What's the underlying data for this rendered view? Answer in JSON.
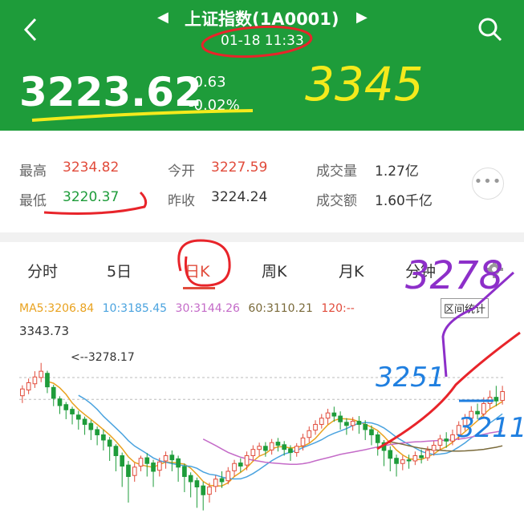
{
  "header": {
    "title": "上证指数(1A0001)",
    "time": "01-18 11:33",
    "price": "3223.62",
    "change": "-0.63",
    "change_pct": "-0.02%",
    "prev_symbol": "◀",
    "next_symbol": "▶"
  },
  "stats": {
    "high_label": "最高",
    "high_value": "3234.82",
    "low_label": "最低",
    "low_value": "3220.37",
    "open_label": "今开",
    "open_value": "3227.59",
    "prev_close_label": "昨收",
    "prev_close_value": "3224.24",
    "volume_label": "成交量",
    "volume_value": "1.27亿",
    "amount_label": "成交额",
    "amount_value": "1.60千亿",
    "more": "•••"
  },
  "tabs": [
    "分时",
    "5日",
    "日K",
    "周K",
    "月K",
    "分钟"
  ],
  "active_tab": "日K",
  "ma": {
    "ma5": "MA5:3206.84",
    "ma10": "10:3185.45",
    "ma30": "30:3144.26",
    "ma60": "60:3110.21",
    "ma120": "120:--"
  },
  "range_button": "区间统计",
  "chart": {
    "max_label": "3343.73",
    "high_marker": "<--3278.17"
  },
  "colors": {
    "header_bg": "#1e9c3a",
    "up": "#e14b3b",
    "down": "#1e9c3a",
    "ma5": "#e9a21f",
    "ma10": "#4aa3df",
    "ma30": "#c46bc8",
    "ma60": "#7a6a3a",
    "annotation_yellow": "#f4ea1c",
    "annotation_red": "#e8242a",
    "annotation_purple": "#8d2fc9",
    "annotation_blue": "#1f7fe0"
  },
  "icons": {
    "back": "chevron-left-icon",
    "search": "search-icon",
    "settings": "gear-icon"
  },
  "handwritten": {
    "yellow_note": "3345",
    "purple_note": "3278",
    "blue_note_1": "3251",
    "blue_note_2": "3211"
  },
  "chart_data": {
    "type": "candlestick",
    "ylim": [
      2990,
      3343.73
    ],
    "candles_ohlc": [
      [
        3215,
        3228,
        3201,
        3235
      ],
      [
        3226,
        3240,
        3218,
        3248
      ],
      [
        3238,
        3251,
        3230,
        3262
      ],
      [
        3250,
        3262,
        3241,
        3278
      ],
      [
        3258,
        3232,
        3220,
        3263
      ],
      [
        3231,
        3210,
        3195,
        3236
      ],
      [
        3209,
        3196,
        3180,
        3214
      ],
      [
        3198,
        3188,
        3170,
        3203
      ],
      [
        3189,
        3180,
        3160,
        3194
      ],
      [
        3178,
        3170,
        3150,
        3186
      ],
      [
        3170,
        3160,
        3140,
        3175
      ],
      [
        3162,
        3150,
        3130,
        3168
      ],
      [
        3150,
        3140,
        3120,
        3156
      ],
      [
        3140,
        3130,
        3110,
        3150
      ],
      [
        3130,
        3118,
        3090,
        3136
      ],
      [
        3118,
        3100,
        3070,
        3122
      ],
      [
        3100,
        3080,
        3040,
        3106
      ],
      [
        3082,
        3060,
        3010,
        3090
      ],
      [
        3062,
        3078,
        3050,
        3086
      ],
      [
        3080,
        3095,
        3070,
        3100
      ],
      [
        3096,
        3085,
        3060,
        3105
      ],
      [
        3086,
        3070,
        3040,
        3092
      ],
      [
        3072,
        3088,
        3060,
        3096
      ],
      [
        3090,
        3100,
        3075,
        3108
      ],
      [
        3101,
        3092,
        3070,
        3110
      ],
      [
        3094,
        3078,
        3050,
        3100
      ],
      [
        3079,
        3060,
        3030,
        3085
      ],
      [
        3062,
        3050,
        3020,
        3068
      ],
      [
        3052,
        3040,
        3000,
        3058
      ],
      [
        3042,
        3025,
        2995,
        3050
      ],
      [
        3026,
        3040,
        3010,
        3048
      ],
      [
        3041,
        3055,
        3030,
        3062
      ],
      [
        3056,
        3050,
        3038,
        3070
      ],
      [
        3052,
        3070,
        3045,
        3078
      ],
      [
        3071,
        3085,
        3060,
        3092
      ],
      [
        3086,
        3080,
        3068,
        3095
      ],
      [
        3082,
        3100,
        3072,
        3108
      ],
      [
        3100,
        3112,
        3090,
        3120
      ],
      [
        3112,
        3118,
        3100,
        3125
      ],
      [
        3118,
        3110,
        3098,
        3126
      ],
      [
        3111,
        3125,
        3102,
        3132
      ],
      [
        3126,
        3120,
        3108,
        3134
      ],
      [
        3121,
        3112,
        3100,
        3128
      ],
      [
        3113,
        3106,
        3090,
        3120
      ],
      [
        3106,
        3118,
        3098,
        3124
      ],
      [
        3119,
        3134,
        3110,
        3142
      ],
      [
        3135,
        3148,
        3125,
        3156
      ],
      [
        3149,
        3160,
        3140,
        3168
      ],
      [
        3160,
        3172,
        3152,
        3180
      ],
      [
        3172,
        3182,
        3160,
        3190
      ],
      [
        3182,
        3176,
        3165,
        3194
      ],
      [
        3176,
        3165,
        3150,
        3185
      ],
      [
        3164,
        3158,
        3140,
        3172
      ],
      [
        3158,
        3166,
        3148,
        3174
      ],
      [
        3166,
        3160,
        3142,
        3176
      ],
      [
        3160,
        3150,
        3130,
        3168
      ],
      [
        3150,
        3140,
        3120,
        3158
      ],
      [
        3140,
        3125,
        3100,
        3146
      ],
      [
        3125,
        3110,
        3080,
        3130
      ],
      [
        3110,
        3095,
        3070,
        3118
      ],
      [
        3095,
        3085,
        3060,
        3102
      ],
      [
        3085,
        3092,
        3072,
        3100
      ],
      [
        3092,
        3090,
        3075,
        3102
      ],
      [
        3090,
        3100,
        3082,
        3108
      ],
      [
        3100,
        3096,
        3085,
        3112
      ],
      [
        3096,
        3110,
        3090,
        3118
      ],
      [
        3110,
        3120,
        3100,
        3128
      ],
      [
        3120,
        3132,
        3110,
        3140
      ],
      [
        3132,
        3128,
        3115,
        3145
      ],
      [
        3128,
        3140,
        3120,
        3150
      ],
      [
        3140,
        3158,
        3130,
        3166
      ],
      [
        3158,
        3172,
        3148,
        3180
      ],
      [
        3172,
        3185,
        3160,
        3195
      ],
      [
        3185,
        3180,
        3170,
        3200
      ],
      [
        3180,
        3200,
        3172,
        3212
      ],
      [
        3200,
        3212,
        3190,
        3225
      ],
      [
        3212,
        3205,
        3195,
        3234
      ],
      [
        3206,
        3223,
        3198,
        3234
      ]
    ],
    "reference_lines": [
      3250,
      3208
    ]
  }
}
